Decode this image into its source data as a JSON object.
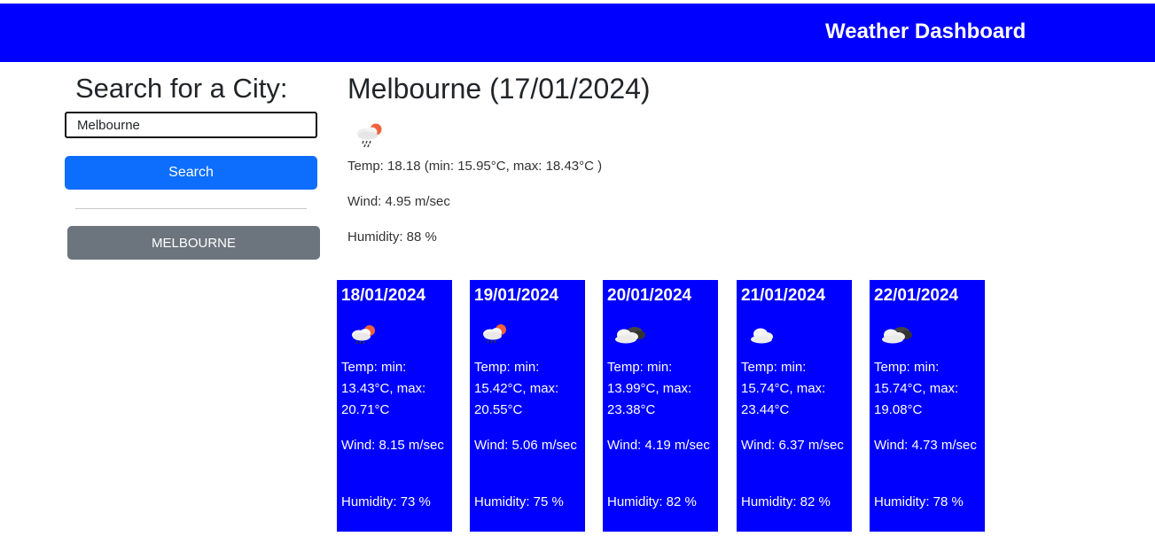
{
  "navbar": {
    "title": "Weather Dashboard"
  },
  "sidebar": {
    "heading": "Search for a City:",
    "search_value": "Melbourne",
    "search_button": "Search",
    "history": [
      "MELBOURNE"
    ]
  },
  "current": {
    "title": "Melbourne (17/01/2024)",
    "icon": "rain-cloud-sun-icon",
    "temp": "Temp: 18.18 (min: 15.95°C, max: 18.43°C )",
    "wind": "Wind: 4.95 m/sec",
    "humidity": "Humidity: 88 %"
  },
  "forecast": [
    {
      "date": "18/01/2024",
      "icon": "rain-cloud-sun-icon",
      "temp": "Temp: min: 13.43°C, max: 20.71°C",
      "wind": "Wind: 8.15 m/sec",
      "humidity": "Humidity: 73 %"
    },
    {
      "date": "19/01/2024",
      "icon": "rain-cloud-sun-icon",
      "temp": "Temp: min: 15.42°C, max: 20.55°C",
      "wind": "Wind: 5.06 m/sec",
      "humidity": "Humidity: 75 %"
    },
    {
      "date": "20/01/2024",
      "icon": "broken-clouds-icon",
      "temp": "Temp: min: 13.99°C, max: 23.38°C",
      "wind": "Wind: 4.19 m/sec",
      "humidity": "Humidity: 82 %"
    },
    {
      "date": "21/01/2024",
      "icon": "cloud-icon",
      "temp": "Temp: min: 15.74°C, max: 23.44°C",
      "wind": "Wind: 6.37 m/sec",
      "humidity": "Humidity: 82 %"
    },
    {
      "date": "22/01/2024",
      "icon": "broken-clouds-icon",
      "temp": "Temp: min: 15.74°C, max: 19.08°C",
      "wind": "Wind: 4.73 m/sec",
      "humidity": "Humidity: 78 %"
    }
  ],
  "colors": {
    "navbar": "#0000ff",
    "card": "#0000ff",
    "search_button": "#0d6efd",
    "history_button": "#6c757d"
  }
}
